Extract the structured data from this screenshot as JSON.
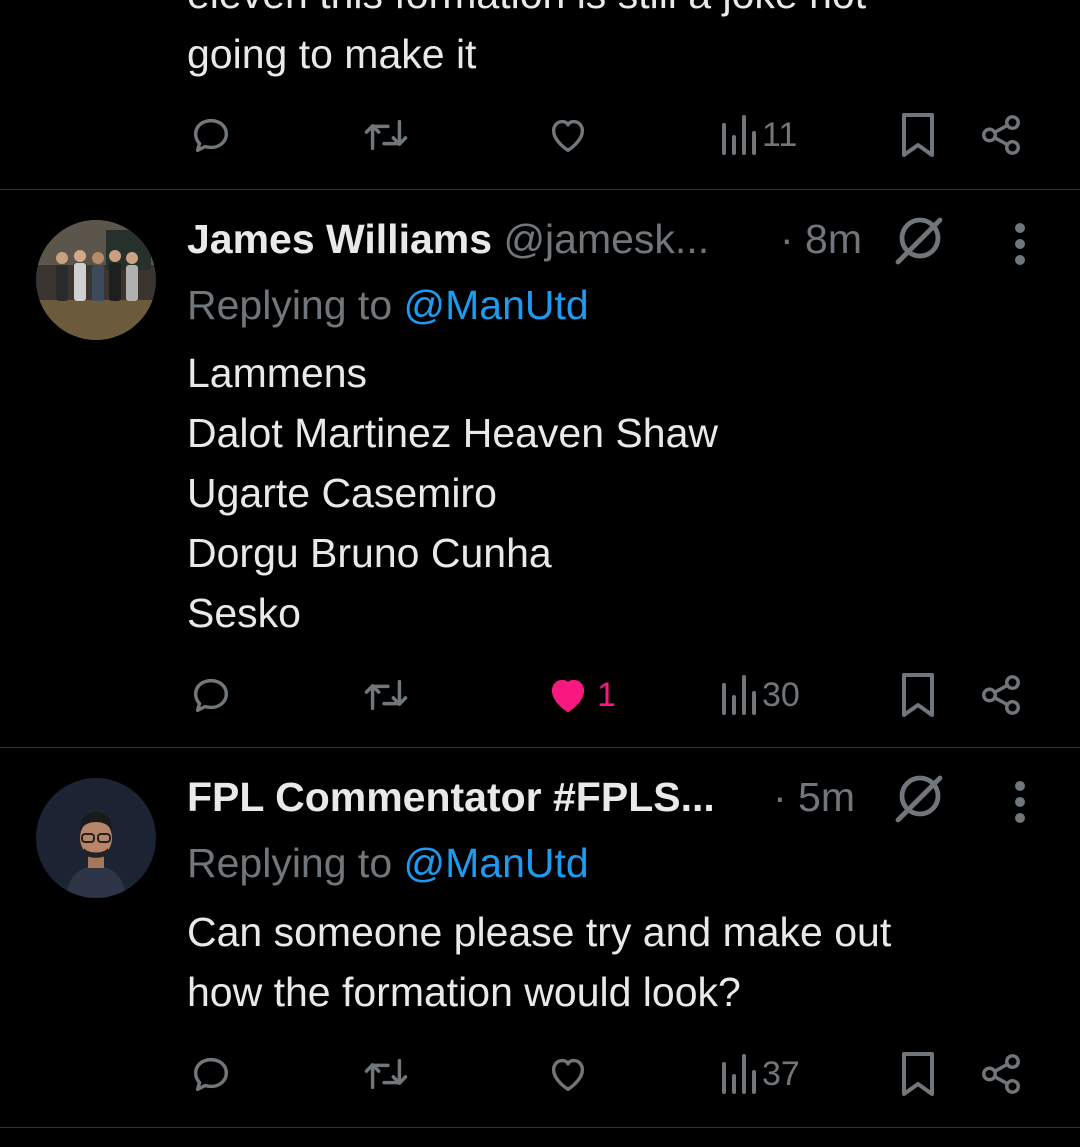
{
  "tweets": [
    {
      "partial_text": [
        "eleven this formation is still a joke not",
        "going to make it"
      ],
      "views": "11",
      "likes": ""
    },
    {
      "name": "James Williams",
      "handle": "@jamesk...",
      "time": "· 8m",
      "replying_prefix": "Replying to",
      "replying_to": "@ManUtd",
      "lines": [
        "Lammens",
        "Dalot Martinez Heaven Shaw",
        "Ugarte Casemiro",
        "Dorgu Bruno Cunha",
        "Sesko"
      ],
      "likes": "1",
      "liked": true,
      "views": "30"
    },
    {
      "name": "FPL Commentator #FPLS...",
      "handle": "",
      "time": "· 5m",
      "replying_prefix": "Replying to",
      "replying_to": "@ManUtd",
      "lines": [
        "Can someone please try and make out",
        "how the formation would look?"
      ],
      "likes": "",
      "liked": false,
      "views": "37"
    }
  ],
  "colors": {
    "background": "#000000",
    "text": "#e7e9ea",
    "muted": "#71767b",
    "accent": "#1d9bf0",
    "like": "#f91880",
    "divider": "#2f3336"
  },
  "icons": [
    "reply-icon",
    "retweet-icon",
    "like-icon",
    "views-icon",
    "bookmark-icon",
    "share-icon",
    "grok-icon",
    "more-icon"
  ]
}
